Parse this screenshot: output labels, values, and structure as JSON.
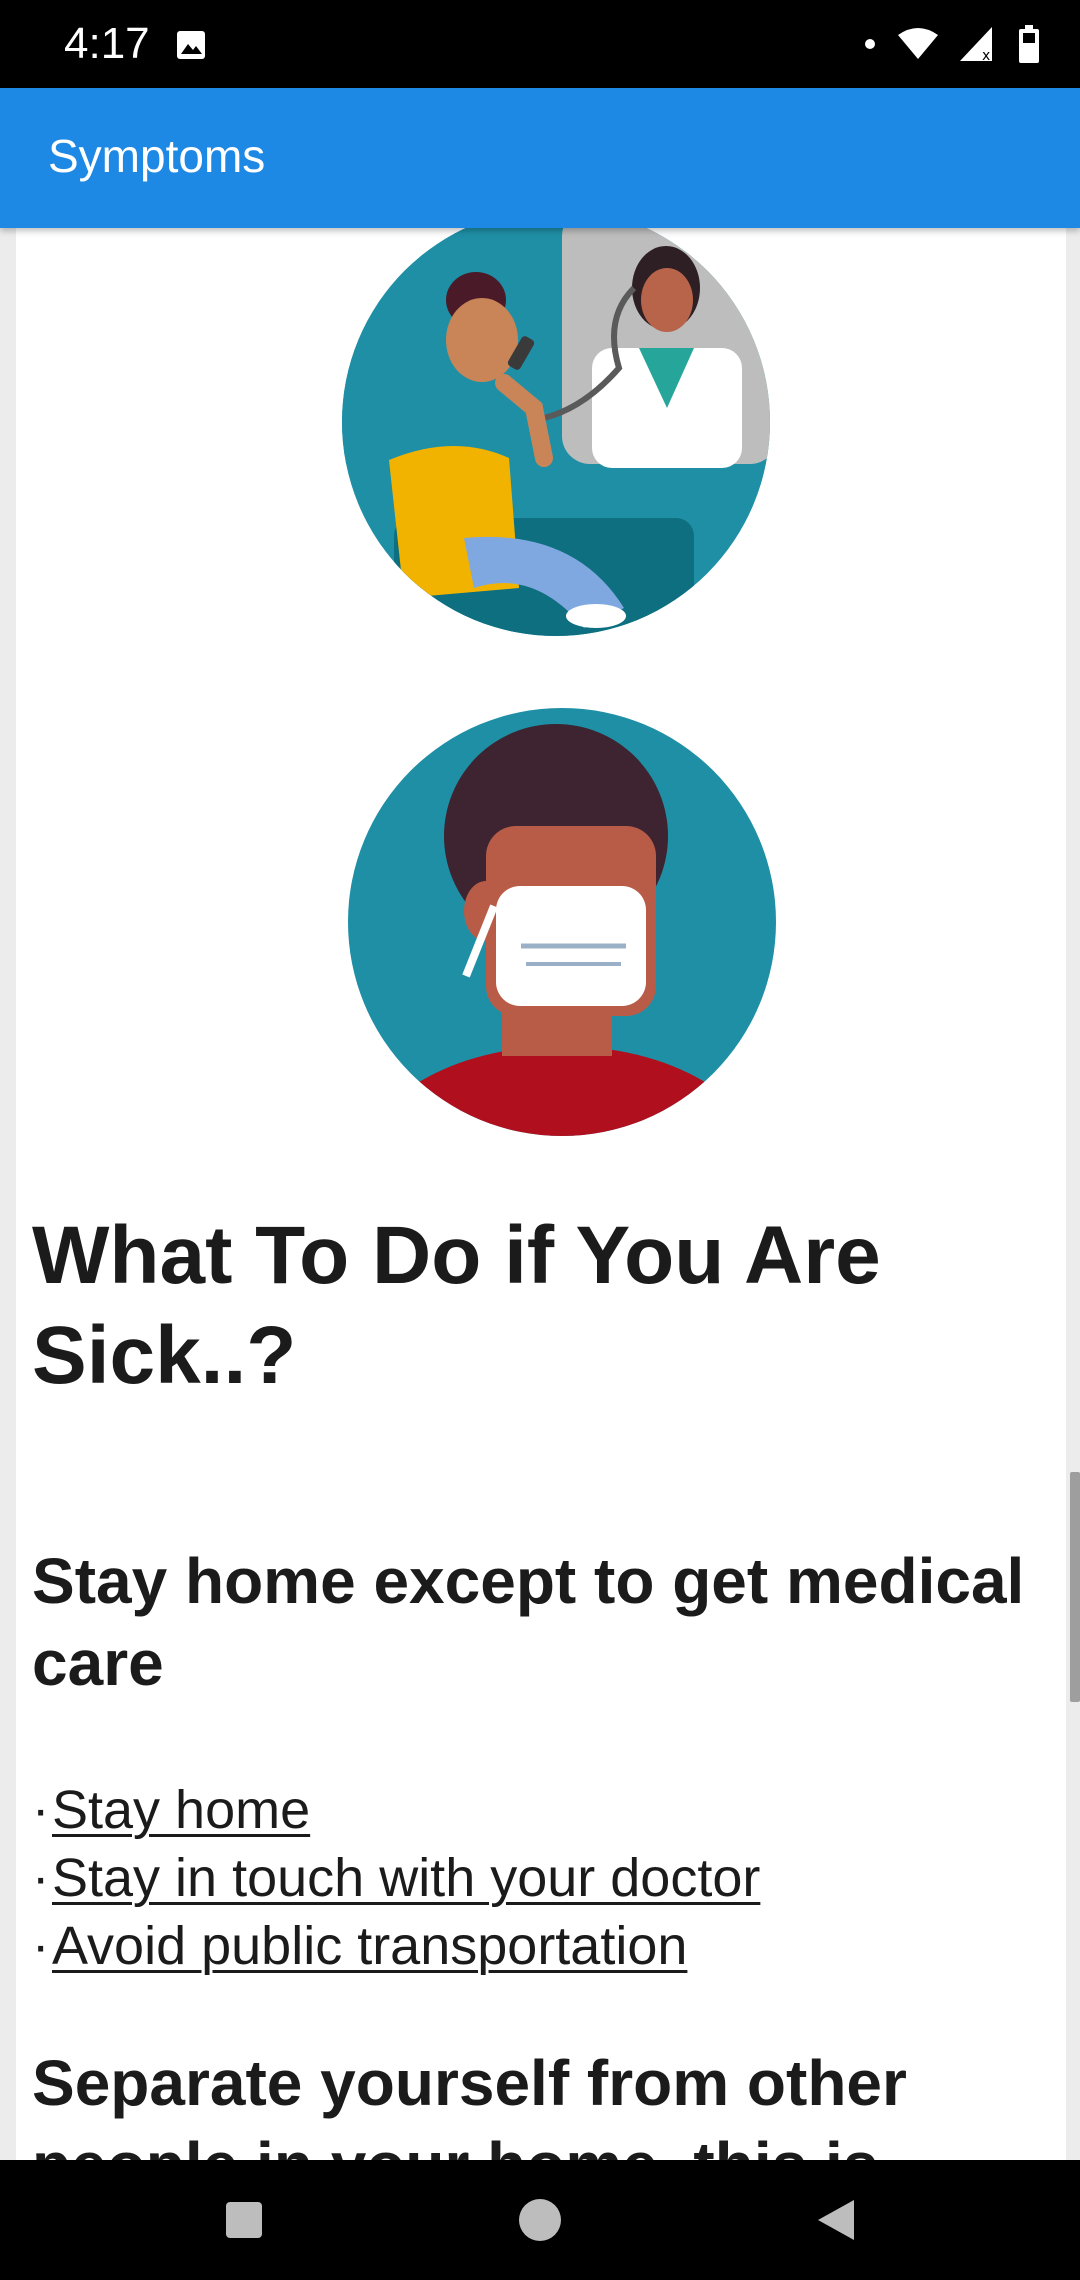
{
  "status_bar": {
    "time": "4:17",
    "icons": [
      "image-icon",
      "dot-icon",
      "wifi-icon",
      "signal-icon",
      "battery-icon"
    ]
  },
  "app_bar": {
    "title": "Symptoms",
    "color": "#1e88e5"
  },
  "content": {
    "illustrations": [
      "phone-call-doctor-illustration",
      "person-wearing-mask-illustration"
    ],
    "heading": "What To Do if You Are Sick..?",
    "section1": {
      "title": "Stay home except to get medical care",
      "bullet": "·",
      "links": [
        "Stay home",
        "Stay in touch with your doctor",
        "Avoid public transportation"
      ]
    },
    "section2": {
      "title": "Separate yourself from other people in your home, this is"
    }
  },
  "nav_bar": {
    "buttons": [
      "recents-button",
      "home-button",
      "back-button"
    ]
  }
}
